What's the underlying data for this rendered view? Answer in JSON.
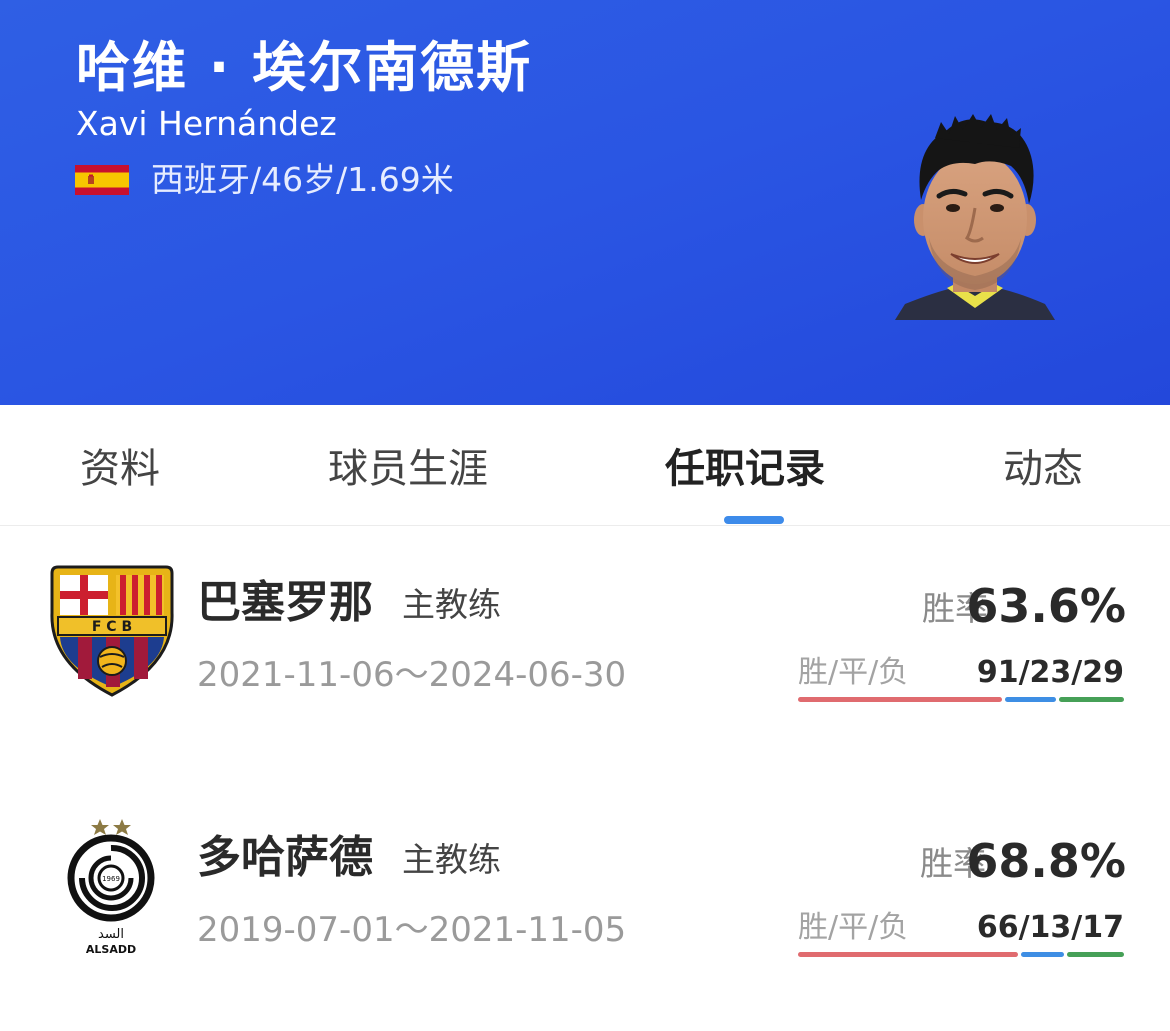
{
  "player": {
    "name_cn": "哈维 · 埃尔南德斯",
    "name_en": "Xavi Hernández",
    "info": "西班牙/46岁/1.69米",
    "flag_icon": "spain-flag-icon"
  },
  "tabs": [
    {
      "label": "资料",
      "active": false
    },
    {
      "label": "球员生涯",
      "active": false
    },
    {
      "label": "任职记录",
      "active": true
    },
    {
      "label": "动态",
      "active": false
    }
  ],
  "records": [
    {
      "team": "巴塞罗那",
      "role": "主教练",
      "dates": "2021-11-06～2024-06-30",
      "rate_label": "胜率",
      "rate": "63.6%",
      "wdl_label": "胜/平/负",
      "wdl": "91/23/29",
      "wins": 91,
      "draws": 23,
      "losses": 29,
      "logo_icon": "fc-barcelona-crest-icon"
    },
    {
      "team": "多哈萨德",
      "role": "主教练",
      "dates": "2019-07-01～2021-11-05",
      "rate_label": "胜率",
      "rate": "68.8%",
      "wdl_label": "胜/平/负",
      "wdl": "66/13/17",
      "wins": 66,
      "draws": 13,
      "losses": 17,
      "logo_icon": "al-sadd-crest-icon",
      "logo_text": "ALSADD"
    }
  ],
  "colors": {
    "header_blue": "#2a55e3",
    "tab_indicator": "#3d8bea",
    "win": "#e06b6f",
    "draw": "#3e8ee4",
    "loss": "#46a057"
  }
}
